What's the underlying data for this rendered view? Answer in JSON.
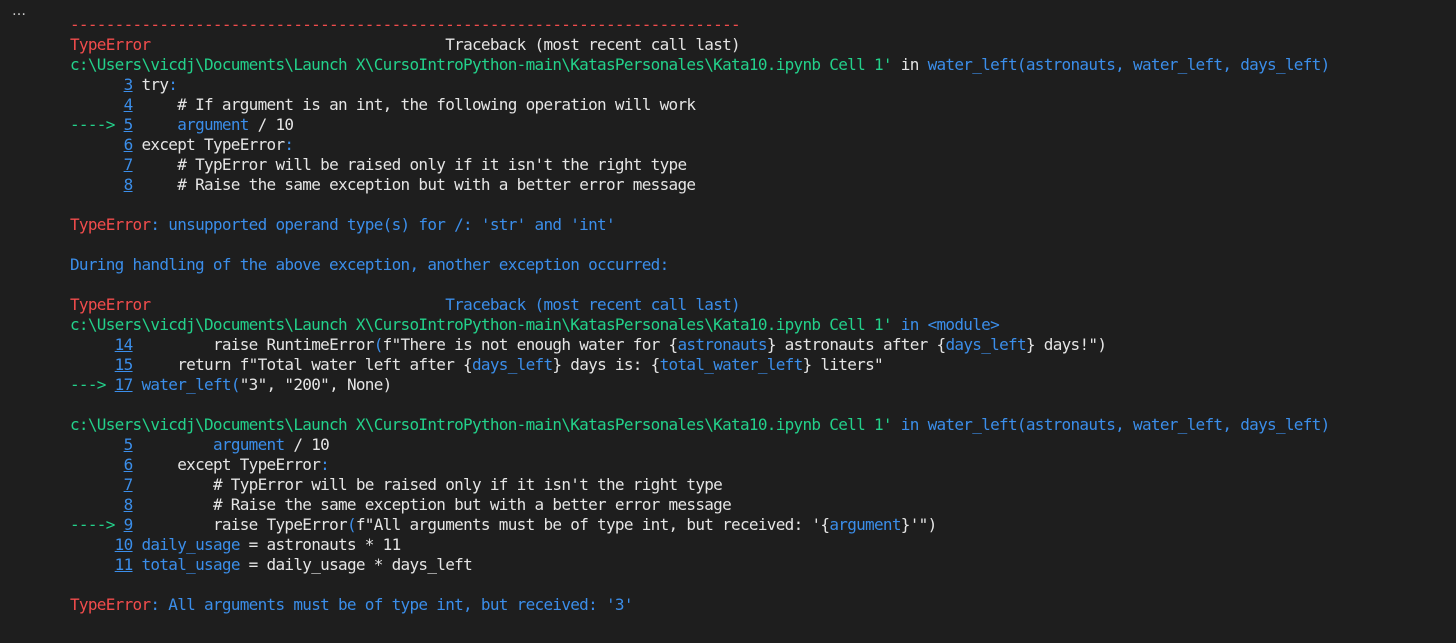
{
  "toolbar": {
    "ellipsis": "…"
  },
  "lines": [
    {
      "kind": "sep",
      "segments": [
        {
          "t": "---------------------------------------------------------------------------",
          "c": "red"
        }
      ]
    },
    {
      "kind": "header",
      "segments": [
        {
          "t": "TypeError",
          "c": "red"
        },
        {
          "t": "                                 ",
          "c": "dim"
        },
        {
          "t": "Traceback (most recent call last)",
          "c": "white"
        }
      ]
    },
    {
      "kind": "path",
      "segments": [
        {
          "t": "c:\\Users\\vicdj\\Documents\\Launch X\\CursoIntroPython-main\\KatasPersonales\\Kata10.ipynb Cell 1'",
          "c": "green"
        },
        {
          "t": " in ",
          "c": "white"
        },
        {
          "t": "water_left(astronauts, water_left, days_left)",
          "c": "blue"
        }
      ]
    },
    {
      "kind": "code",
      "segments": [
        {
          "t": "      ",
          "c": "dim"
        },
        {
          "t": "3",
          "c": "ln",
          "link": true
        },
        {
          "t": " try",
          "c": "white"
        },
        {
          "t": ":",
          "c": "blue"
        }
      ]
    },
    {
      "kind": "code",
      "segments": [
        {
          "t": "      ",
          "c": "dim"
        },
        {
          "t": "4",
          "c": "ln",
          "link": true
        },
        {
          "t": "     # If argument is an int, the following operation will work",
          "c": "white"
        }
      ]
    },
    {
      "kind": "code",
      "segments": [
        {
          "t": "----> ",
          "c": "green"
        },
        {
          "t": "5",
          "c": "ln",
          "link": true
        },
        {
          "t": "     ",
          "c": "dim"
        },
        {
          "t": "argument",
          "c": "blue"
        },
        {
          "t": " / 10",
          "c": "white"
        }
      ]
    },
    {
      "kind": "code",
      "segments": [
        {
          "t": "      ",
          "c": "dim"
        },
        {
          "t": "6",
          "c": "ln",
          "link": true
        },
        {
          "t": " except TypeError",
          "c": "white"
        },
        {
          "t": ":",
          "c": "blue"
        }
      ]
    },
    {
      "kind": "code",
      "segments": [
        {
          "t": "      ",
          "c": "dim"
        },
        {
          "t": "7",
          "c": "ln",
          "link": true
        },
        {
          "t": "     # TypError will be raised only if it isn't the right type",
          "c": "white"
        }
      ]
    },
    {
      "kind": "code",
      "segments": [
        {
          "t": "      ",
          "c": "dim"
        },
        {
          "t": "8",
          "c": "ln",
          "link": true
        },
        {
          "t": "     # Raise the same exception but with a better error message",
          "c": "white"
        }
      ]
    },
    {
      "kind": "blank",
      "segments": []
    },
    {
      "kind": "error",
      "segments": [
        {
          "t": "TypeError",
          "c": "red"
        },
        {
          "t": ": unsupported operand type(s) for /: 'str' and 'int'",
          "c": "blue"
        }
      ]
    },
    {
      "kind": "blank",
      "segments": []
    },
    {
      "kind": "info",
      "segments": [
        {
          "t": "During handling of the above exception, another exception occurred:",
          "c": "blue"
        }
      ]
    },
    {
      "kind": "blank",
      "segments": []
    },
    {
      "kind": "header",
      "segments": [
        {
          "t": "TypeError",
          "c": "red"
        },
        {
          "t": "                                 ",
          "c": "dim"
        },
        {
          "t": "Traceback (most recent call last)",
          "c": "blue"
        }
      ]
    },
    {
      "kind": "path",
      "segments": [
        {
          "t": "c:\\Users\\vicdj\\Documents\\Launch X\\CursoIntroPython-main\\KatasPersonales\\Kata10.ipynb Cell 1'",
          "c": "green"
        },
        {
          "t": " in ",
          "c": "blue"
        },
        {
          "t": "<module>",
          "c": "blue"
        }
      ]
    },
    {
      "kind": "code",
      "segments": [
        {
          "t": "     ",
          "c": "dim"
        },
        {
          "t": "14",
          "c": "ln",
          "link": true
        },
        {
          "t": "         raise RuntimeError",
          "c": "white"
        },
        {
          "t": "(",
          "c": "blue"
        },
        {
          "t": "f\"There is not enough water for {",
          "c": "white"
        },
        {
          "t": "astronauts",
          "c": "blue"
        },
        {
          "t": "} astronauts after {",
          "c": "white"
        },
        {
          "t": "days_left",
          "c": "blue"
        },
        {
          "t": "} days!\")",
          "c": "white"
        }
      ]
    },
    {
      "kind": "code",
      "segments": [
        {
          "t": "     ",
          "c": "dim"
        },
        {
          "t": "15",
          "c": "ln",
          "link": true
        },
        {
          "t": "     return f\"Total water left after {",
          "c": "white"
        },
        {
          "t": "days_left",
          "c": "blue"
        },
        {
          "t": "} days is: {",
          "c": "white"
        },
        {
          "t": "total_water_left",
          "c": "blue"
        },
        {
          "t": "} liters\"",
          "c": "white"
        }
      ]
    },
    {
      "kind": "code",
      "segments": [
        {
          "t": "---> ",
          "c": "green"
        },
        {
          "t": "17",
          "c": "ln",
          "link": true
        },
        {
          "t": " ",
          "c": "dim"
        },
        {
          "t": "water_left(",
          "c": "blue"
        },
        {
          "t": "\"3\", \"200\", None)",
          "c": "white"
        }
      ]
    },
    {
      "kind": "blank",
      "segments": []
    },
    {
      "kind": "path",
      "segments": [
        {
          "t": "c:\\Users\\vicdj\\Documents\\Launch X\\CursoIntroPython-main\\KatasPersonales\\Kata10.ipynb Cell 1'",
          "c": "green"
        },
        {
          "t": " in ",
          "c": "blue"
        },
        {
          "t": "water_left(astronauts, water_left, days_left)",
          "c": "blue"
        }
      ]
    },
    {
      "kind": "code",
      "segments": [
        {
          "t": "      ",
          "c": "dim"
        },
        {
          "t": "5",
          "c": "ln",
          "link": true
        },
        {
          "t": "         ",
          "c": "dim"
        },
        {
          "t": "argument",
          "c": "blue"
        },
        {
          "t": " / 10",
          "c": "white"
        }
      ]
    },
    {
      "kind": "code",
      "segments": [
        {
          "t": "      ",
          "c": "dim"
        },
        {
          "t": "6",
          "c": "ln",
          "link": true
        },
        {
          "t": "     except TypeError",
          "c": "white"
        },
        {
          "t": ":",
          "c": "blue"
        }
      ]
    },
    {
      "kind": "code",
      "segments": [
        {
          "t": "      ",
          "c": "dim"
        },
        {
          "t": "7",
          "c": "ln",
          "link": true
        },
        {
          "t": "         # TypError will be raised only if it isn't the right type",
          "c": "white"
        }
      ]
    },
    {
      "kind": "code",
      "segments": [
        {
          "t": "      ",
          "c": "dim"
        },
        {
          "t": "8",
          "c": "ln",
          "link": true
        },
        {
          "t": "         # Raise the same exception but with a better error message",
          "c": "white"
        }
      ]
    },
    {
      "kind": "code",
      "segments": [
        {
          "t": "----> ",
          "c": "green"
        },
        {
          "t": "9",
          "c": "ln",
          "link": true
        },
        {
          "t": "         raise TypeError",
          "c": "white"
        },
        {
          "t": "(",
          "c": "blue"
        },
        {
          "t": "f\"All arguments must be of type int, but received: '{",
          "c": "white"
        },
        {
          "t": "argument",
          "c": "blue"
        },
        {
          "t": "}'\")",
          "c": "white"
        }
      ]
    },
    {
      "kind": "code",
      "segments": [
        {
          "t": "     ",
          "c": "dim"
        },
        {
          "t": "10",
          "c": "ln",
          "link": true
        },
        {
          "t": " ",
          "c": "dim"
        },
        {
          "t": "daily_usage",
          "c": "blue"
        },
        {
          "t": " = astronauts * 11",
          "c": "white"
        }
      ]
    },
    {
      "kind": "code",
      "segments": [
        {
          "t": "     ",
          "c": "dim"
        },
        {
          "t": "11",
          "c": "ln",
          "link": true
        },
        {
          "t": " ",
          "c": "dim"
        },
        {
          "t": "total_usage",
          "c": "blue"
        },
        {
          "t": " = daily_usage * days_left",
          "c": "white"
        }
      ]
    },
    {
      "kind": "blank",
      "segments": []
    },
    {
      "kind": "error",
      "segments": [
        {
          "t": "TypeError",
          "c": "red"
        },
        {
          "t": ": All arguments must be of type int, but received: '3'",
          "c": "blue"
        }
      ]
    }
  ]
}
